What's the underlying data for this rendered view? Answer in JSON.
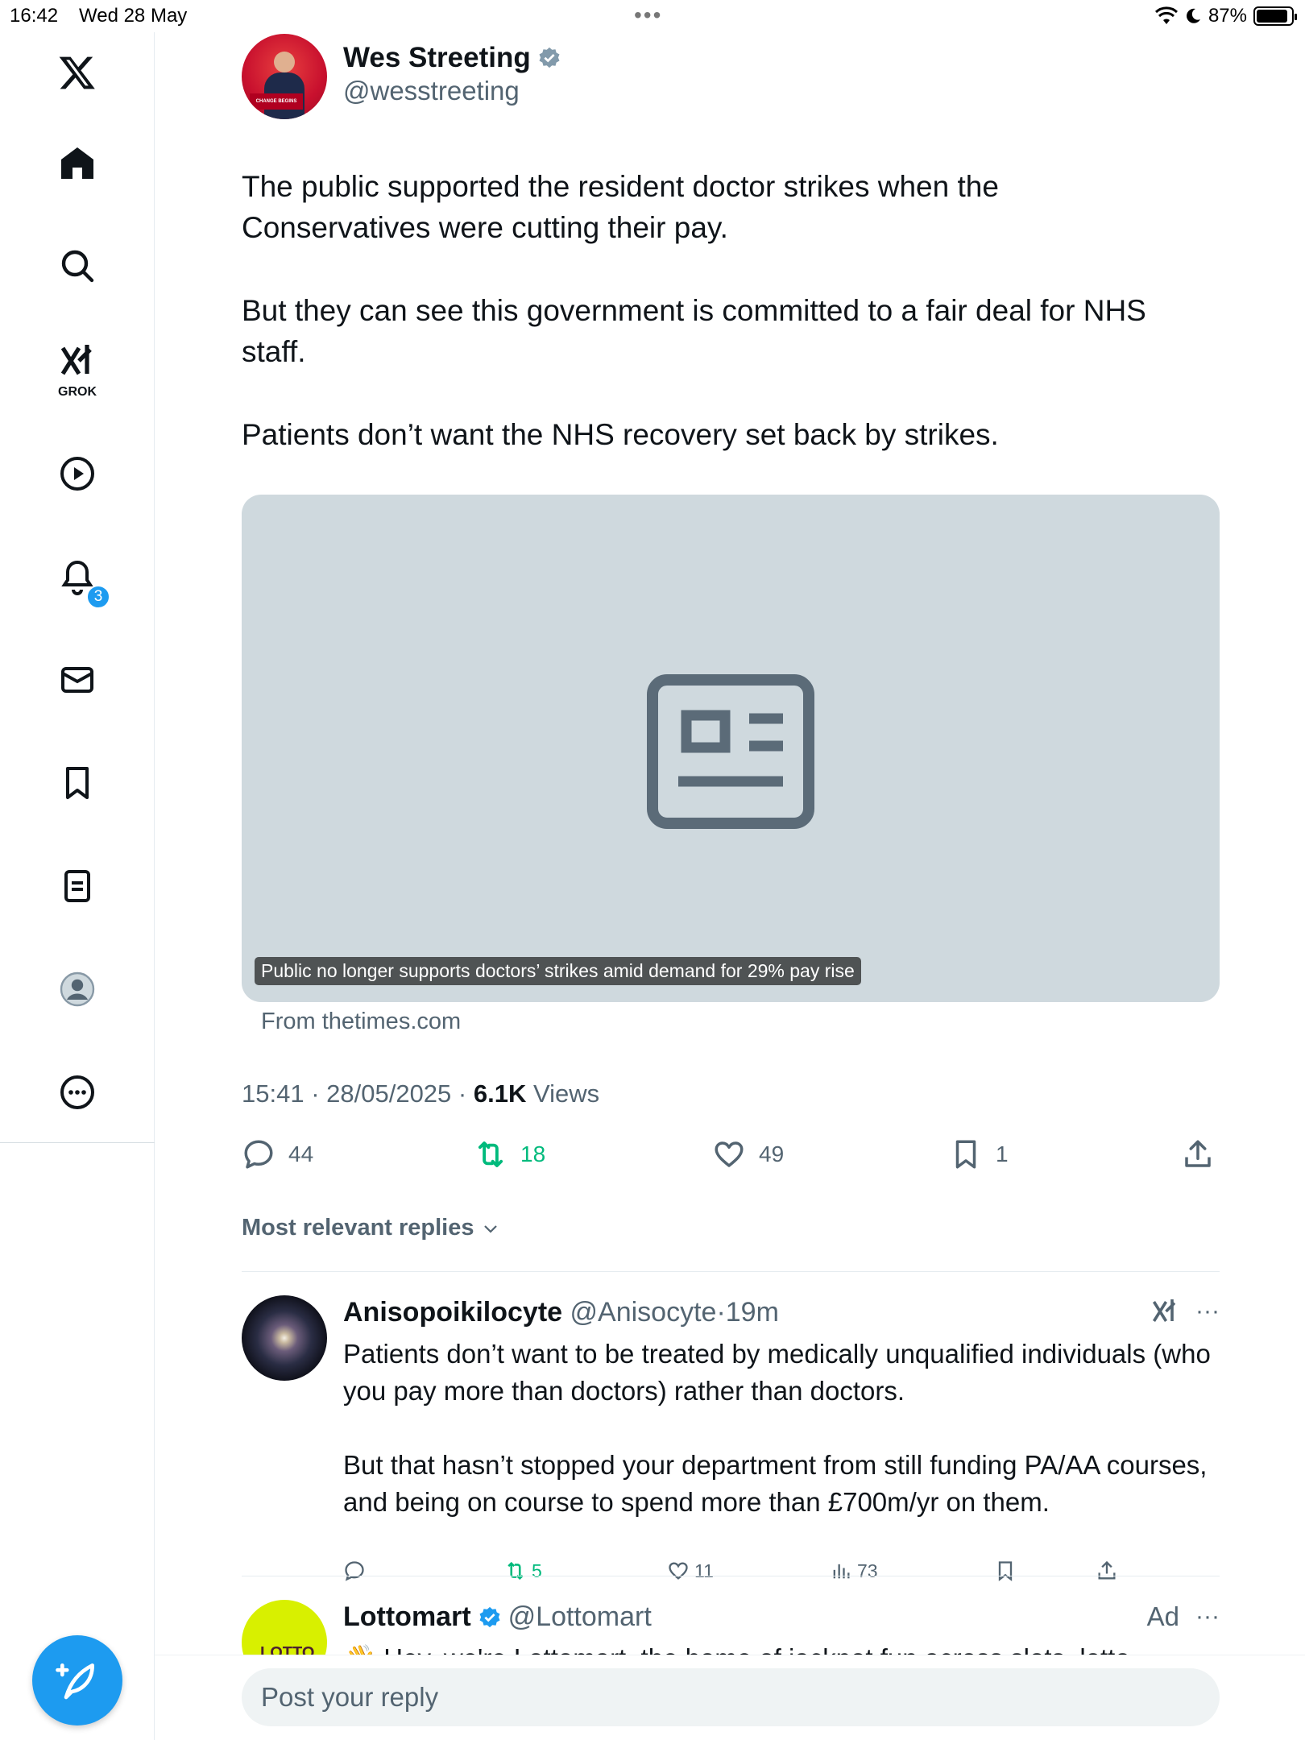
{
  "status_bar": {
    "time": "16:42",
    "date": "Wed 28 May",
    "battery": "87%"
  },
  "sidebar": {
    "grok_label": "GROK",
    "notifications_count": "3"
  },
  "tweet": {
    "author": {
      "name": "Wes Streeting",
      "handle": "@wesstreeting",
      "verified": true
    },
    "paragraphs": [
      "The public supported the resident doctor strikes when the\nConservatives were cutting their pay.",
      "But they can see this government is committed to a fair deal for NHS\nstaff.",
      "Patients don’t want the NHS recovery set back by strikes."
    ],
    "card": {
      "caption": "Public no longer supports doctors’ strikes amid demand for 29% pay rise",
      "source": "From thetimes.com"
    },
    "meta": {
      "time": "15:41",
      "date": "28/05/2025",
      "views_count": "6.1K",
      "views_label": "Views"
    },
    "stats": {
      "replies": "44",
      "reposts": "18",
      "likes": "49",
      "bookmarks": "1"
    }
  },
  "replies_sort_label": "Most relevant replies",
  "replies": [
    {
      "name": "Anisopoikilocyte",
      "handle": "@Anisocyte",
      "time": "19m",
      "paragraphs": [
        "Patients don’t want to be treated by medically unqualified individuals (who you pay more than doctors) rather than doctors.",
        "But that hasn’t stopped your department from still funding PA/AA courses, and being on course to spend more than £700m/yr on them."
      ],
      "stats": {
        "reposts": "5",
        "likes": "11",
        "views": "73"
      }
    },
    {
      "name": "Lottomart",
      "handle": "@Lottomart",
      "ad_label": "Ad",
      "avatar_text": "LOTTO MART",
      "text": "👋 Hey, we're Lottomart, the home of jackpot fun across slots, lotto"
    }
  ],
  "reply_input": {
    "placeholder": "Post your reply"
  },
  "colors": {
    "accent": "#1d9bf0",
    "repost_green": "#00ba7c",
    "secondary_text": "#536471"
  }
}
